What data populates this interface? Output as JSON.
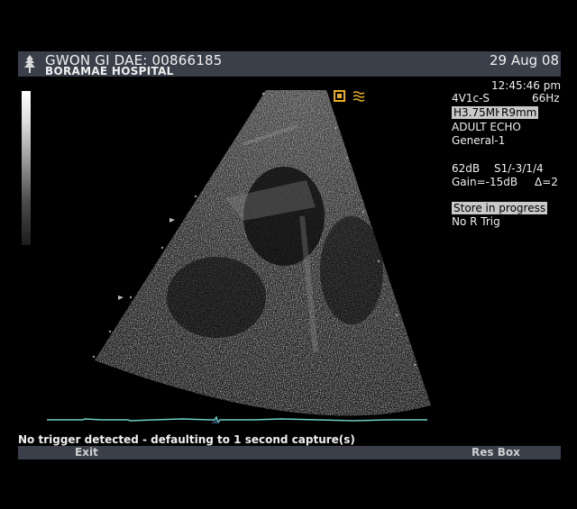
{
  "header": {
    "patient": "GWON GI DAE: 00866185",
    "hospital": "BORAMAE HOSPITAL",
    "date": "29 Aug 08"
  },
  "info": {
    "time": "12:45:46 pm",
    "probe": "4V1c-S",
    "frame_rate": "66Hz",
    "frequency": "H3.75MHz",
    "depth": "R9mm",
    "application": "ADULT ECHO",
    "preset": "General-1",
    "dynamic_range": "62dB",
    "settings": "S1/-3/1/4",
    "gain": "Gain=-15dB",
    "delta": "Δ=2",
    "store_status": "Store in progress",
    "trigger": "No R Trig"
  },
  "status": {
    "message": "No trigger detected - defaulting to 1 second capture(s)"
  },
  "footer": {
    "exit_label": "Exit",
    "resbox_label": "Res Box"
  },
  "colors": {
    "header_bg": "#3a3f4a",
    "orientation_marker": "#e8b020",
    "ecg_trace": "#6fd0c8"
  }
}
